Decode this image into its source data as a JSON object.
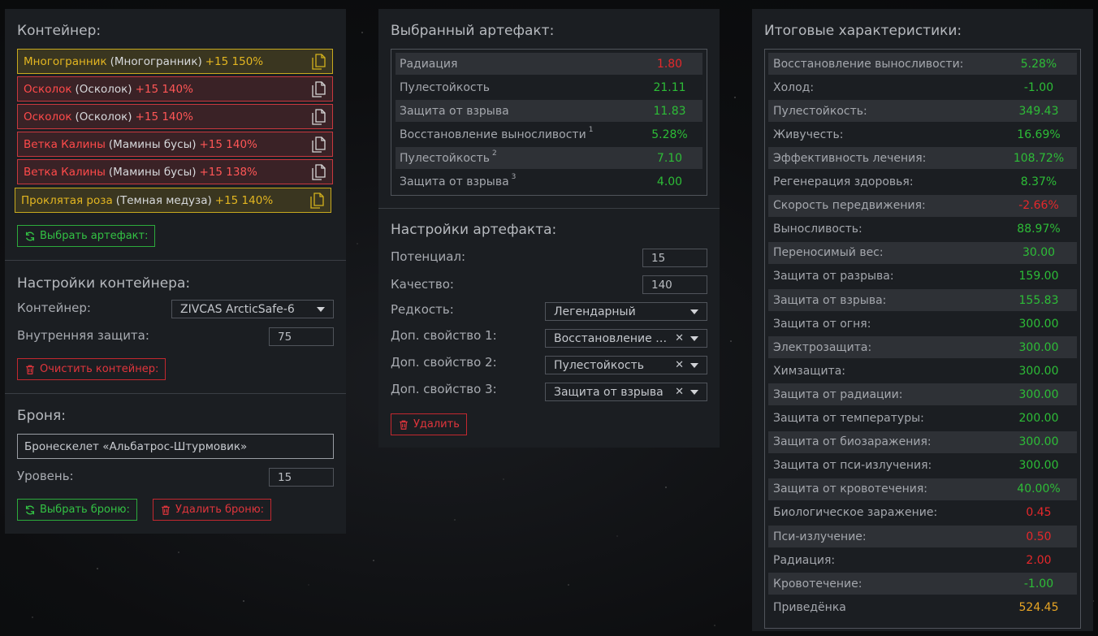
{
  "colors": {
    "positive": "#2dbd37",
    "negative": "#e5282b",
    "highlight": "#e8a524",
    "gold_item": "#e3b620",
    "red_item": "#ff4a4a"
  },
  "container_panel": {
    "title": "Контейнер:",
    "items": [
      {
        "name": "Многогранник",
        "sub": "(Многогранник)",
        "level": "+15 150%",
        "style": "gold",
        "icon": "copy-icon"
      },
      {
        "name": "Осколок",
        "sub": "(Осколок)",
        "level": "+15 140%",
        "style": "red",
        "icon": "copy-icon"
      },
      {
        "name": "Осколок",
        "sub": "(Осколок)",
        "level": "+15 140%",
        "style": "red",
        "icon": "copy-icon"
      },
      {
        "name": "Ветка Калины",
        "sub": "(Мамины бусы)",
        "level": "+15 140%",
        "style": "red",
        "icon": "copy-icon"
      },
      {
        "name": "Ветка Калины",
        "sub": "(Мамины бусы)",
        "level": "+15 138%",
        "style": "red",
        "icon": "copy-icon"
      },
      {
        "name": "Проклятая роза",
        "sub": "(Темная медуза)",
        "level": "+15 140%",
        "style": "gold",
        "icon": "copy-icon"
      }
    ],
    "select_artifact_label": "Выбрать артефакт:",
    "settings_title": "Настройки контейнера:",
    "container_label": "Контейнер:",
    "container_value": "ZIVCAS ArcticSafe-6",
    "inner_protection_label": "Внутренняя защита:",
    "inner_protection_value": "75",
    "clear_label": "Очистить контейнер:",
    "armor_title": "Броня:",
    "armor_value": "Бронескелет «Альбатрос-Штурмовик»",
    "armor_level_label": "Уровень:",
    "armor_level_value": "15",
    "select_armor_label": "Выбрать броню:",
    "delete_armor_label": "Удалить броню:"
  },
  "artifact_panel": {
    "title": "Выбранный артефакт:",
    "stats": [
      {
        "label": "Радиация",
        "sup": "",
        "value": "1.80",
        "tone": "r"
      },
      {
        "label": "Пулестойкость",
        "sup": "",
        "value": "21.11",
        "tone": "g"
      },
      {
        "label": "Защита от взрыва",
        "sup": "",
        "value": "11.83",
        "tone": "g"
      },
      {
        "label": "Восстановление выносливости",
        "sup": "1",
        "value": "5.28%",
        "tone": "g"
      },
      {
        "label": "Пулестойкость",
        "sup": "2",
        "value": "7.10",
        "tone": "g"
      },
      {
        "label": "Защита от взрыва",
        "sup": "3",
        "value": "4.00",
        "tone": "g"
      }
    ],
    "settings_title": "Настройки артефакта:",
    "potential_label": "Потенциал:",
    "potential_value": "15",
    "quality_label": "Качество:",
    "quality_value": "140",
    "rarity_label": "Редкость:",
    "rarity_value": "Легендарный",
    "extra1_label": "Доп. свойство 1:",
    "extra1_value": "Восстановление выносливости",
    "extra2_label": "Доп. свойство 2:",
    "extra2_value": "Пулестойкость",
    "extra3_label": "Доп. свойство 3:",
    "extra3_value": "Защита от взрыва",
    "delete_label": "Удалить"
  },
  "totals_panel": {
    "title": "Итоговые характеристики:",
    "stats": [
      {
        "label": "Восстановление выносливости:",
        "value": "5.28%",
        "tone": "g"
      },
      {
        "label": "Холод:",
        "value": "-1.00",
        "tone": "g"
      },
      {
        "label": "Пулестойкость:",
        "value": "349.43",
        "tone": "g"
      },
      {
        "label": "Живучесть:",
        "value": "16.69%",
        "tone": "g"
      },
      {
        "label": "Эффективность лечения:",
        "value": "108.72%",
        "tone": "g"
      },
      {
        "label": "Регенерация здоровья:",
        "value": "8.37%",
        "tone": "g"
      },
      {
        "label": "Скорость передвижения:",
        "value": "-2.66%",
        "tone": "r"
      },
      {
        "label": "Выносливость:",
        "value": "88.97%",
        "tone": "g"
      },
      {
        "label": "Переносимый вес:",
        "value": "30.00",
        "tone": "g"
      },
      {
        "label": "Защита от разрыва:",
        "value": "159.00",
        "tone": "g"
      },
      {
        "label": "Защита от взрыва:",
        "value": "155.83",
        "tone": "g"
      },
      {
        "label": "Защита от огня:",
        "value": "300.00",
        "tone": "g"
      },
      {
        "label": "Электрозащита:",
        "value": "300.00",
        "tone": "g"
      },
      {
        "label": "Химзащита:",
        "value": "300.00",
        "tone": "g"
      },
      {
        "label": "Защита от радиации:",
        "value": "300.00",
        "tone": "g"
      },
      {
        "label": "Защита от температуры:",
        "value": "200.00",
        "tone": "g"
      },
      {
        "label": "Защита от биозаражения:",
        "value": "300.00",
        "tone": "g"
      },
      {
        "label": "Защита от пси-излучения:",
        "value": "300.00",
        "tone": "g"
      },
      {
        "label": "Защита от кровотечения:",
        "value": "40.00%",
        "tone": "g"
      },
      {
        "label": "Биологическое заражение:",
        "value": "0.45",
        "tone": "r"
      },
      {
        "label": "Пси-излучение:",
        "value": "0.50",
        "tone": "r"
      },
      {
        "label": "Радиация:",
        "value": "2.00",
        "tone": "r"
      },
      {
        "label": "Кровотечение:",
        "value": "-1.00",
        "tone": "g"
      },
      {
        "label": "Приведёнка",
        "value": "524.45",
        "tone": "o"
      }
    ]
  }
}
